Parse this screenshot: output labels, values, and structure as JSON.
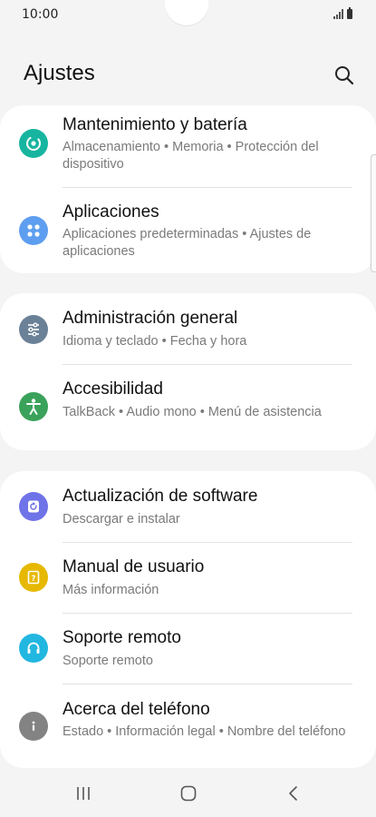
{
  "status_bar": {
    "time": "10:00"
  },
  "header": {
    "title": "Ajustes"
  },
  "groups": [
    {
      "items": [
        {
          "title": "Mantenimiento y batería",
          "subtitle": "Almacenamiento • Memoria • Protección del dispositivo",
          "icon": "device-care-icon",
          "color": "#17b5a0"
        },
        {
          "title": "Aplicaciones",
          "subtitle": "Aplicaciones predeterminadas • Ajustes de aplicaciones",
          "icon": "apps-icon",
          "color": "#5e9ef0"
        }
      ]
    },
    {
      "items": [
        {
          "title": "Administración general",
          "subtitle": "Idioma y teclado • Fecha y hora",
          "icon": "sliders-icon",
          "color": "#6a8198"
        },
        {
          "title": "Accesibilidad",
          "subtitle": "TalkBack • Audio mono • Menú de asistencia",
          "icon": "accessibility-icon",
          "color": "#3aa25a"
        }
      ]
    },
    {
      "items": [
        {
          "title": "Actualización de software",
          "subtitle": "Descargar e instalar",
          "icon": "software-update-icon",
          "color": "#6f73e8"
        },
        {
          "title": "Manual de usuario",
          "subtitle": "Más información",
          "icon": "user-manual-icon",
          "color": "#e6b800"
        },
        {
          "title": "Soporte remoto",
          "subtitle": "Soporte remoto",
          "icon": "headset-icon",
          "color": "#22b7e0"
        },
        {
          "title": "Acerca del teléfono",
          "subtitle": "Estado • Información legal • Nombre del teléfono",
          "icon": "info-icon",
          "color": "#838383"
        }
      ]
    }
  ],
  "navbar": {
    "buttons": [
      "recent-apps-icon",
      "home-icon",
      "back-icon"
    ]
  }
}
